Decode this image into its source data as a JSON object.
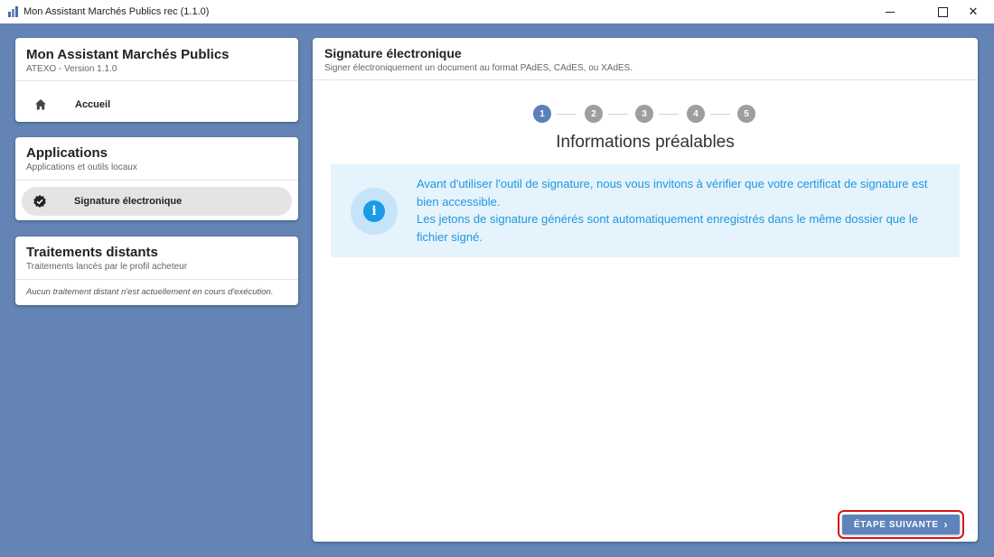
{
  "window": {
    "title": "Mon Assistant Marchés Publics rec (1.1.0)",
    "close_glyph": "✕"
  },
  "sidebar": {
    "header": {
      "title": "Mon Assistant Marchés Publics",
      "subtitle": "ATEXO - Version 1.1.0",
      "nav_home": "Accueil"
    },
    "applications": {
      "title": "Applications",
      "subtitle": "Applications et outils locaux",
      "items": [
        {
          "label": "Signature électronique",
          "icon": "verified-badge-icon",
          "selected": true
        }
      ]
    },
    "remote": {
      "title": "Traitements distants",
      "subtitle": "Traitements lancés par le profil acheteur",
      "empty_message": "Aucun traitement distant n'est actuellement en cours d'exécution."
    }
  },
  "main": {
    "title": "Signature électronique",
    "subtitle": "Signer électroniquement un document au format PAdES, CAdES, ou XAdES.",
    "steps": [
      "1",
      "2",
      "3",
      "4",
      "5"
    ],
    "active_step": 1,
    "step_title": "Informations préalables",
    "info": {
      "line1": "Avant d'utiliser l'outil de signature, nous vous invitons à vérifier que votre certificat de signature est bien accessible.",
      "line2": "Les jetons de signature générés sont automatiquement enregistrés dans le même dossier que le fichier signé.",
      "icon_glyph": "i"
    },
    "next_button": "ÉTAPE SUIVANTE",
    "next_chevron": "›"
  },
  "colors": {
    "background": "#6384b4",
    "accent": "#5c80b8",
    "info_text": "#1f97e0",
    "info_bg": "#e5f3fc"
  }
}
